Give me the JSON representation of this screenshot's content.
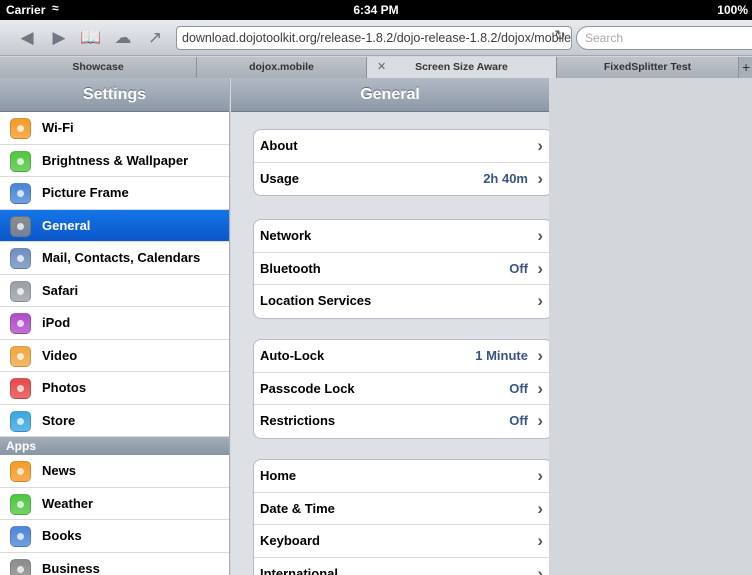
{
  "status_bar": {
    "carrier": "Carrier",
    "time": "6:34 PM",
    "battery": "100%"
  },
  "toolbar": {
    "url": "download.dojotoolkit.org/release-1.8.2/dojo-release-1.8.2/dojox/mobile/",
    "search_placeholder": "Search"
  },
  "tabs": [
    {
      "label": "Showcase"
    },
    {
      "label": "dojox.mobile"
    },
    {
      "label": "Screen Size Aware"
    },
    {
      "label": "FixedSplitter Test"
    }
  ],
  "sidebar": {
    "title": "Settings",
    "items": [
      {
        "label": "Wi-Fi",
        "color": "#f59a26"
      },
      {
        "label": "Brightness & Wallpaper",
        "color": "#4fc740"
      },
      {
        "label": "Picture Frame",
        "color": "#4b86d8"
      },
      {
        "label": "General",
        "color": "#8c8c8c"
      },
      {
        "label": "Mail, Contacts, Calendars",
        "color": "#6f8fbf"
      },
      {
        "label": "Safari",
        "color": "#9aa0a8"
      },
      {
        "label": "iPod",
        "color": "#b04dc8"
      },
      {
        "label": "Video",
        "color": "#f0a740"
      },
      {
        "label": "Photos",
        "color": "#e84949"
      },
      {
        "label": "Store",
        "color": "#3aa7e0"
      }
    ],
    "apps_header": "Apps",
    "apps": [
      {
        "label": "News",
        "color": "#f59a26"
      },
      {
        "label": "Weather",
        "color": "#4fc740"
      },
      {
        "label": "Books",
        "color": "#4b86d8"
      },
      {
        "label": "Business",
        "color": "#8c8c8c"
      }
    ]
  },
  "main": {
    "title": "General",
    "groups": [
      [
        {
          "label": "About",
          "value": ""
        },
        {
          "label": "Usage",
          "value": "2h 40m"
        }
      ],
      [
        {
          "label": "Network",
          "value": ""
        },
        {
          "label": "Bluetooth",
          "value": "Off"
        },
        {
          "label": "Location Services",
          "value": ""
        }
      ],
      [
        {
          "label": "Auto-Lock",
          "value": "1 Minute"
        },
        {
          "label": "Passcode Lock",
          "value": "Off"
        },
        {
          "label": "Restrictions",
          "value": "Off"
        }
      ],
      [
        {
          "label": "Home",
          "value": ""
        },
        {
          "label": "Date & Time",
          "value": ""
        },
        {
          "label": "Keyboard",
          "value": ""
        },
        {
          "label": "International",
          "value": ""
        }
      ]
    ]
  }
}
